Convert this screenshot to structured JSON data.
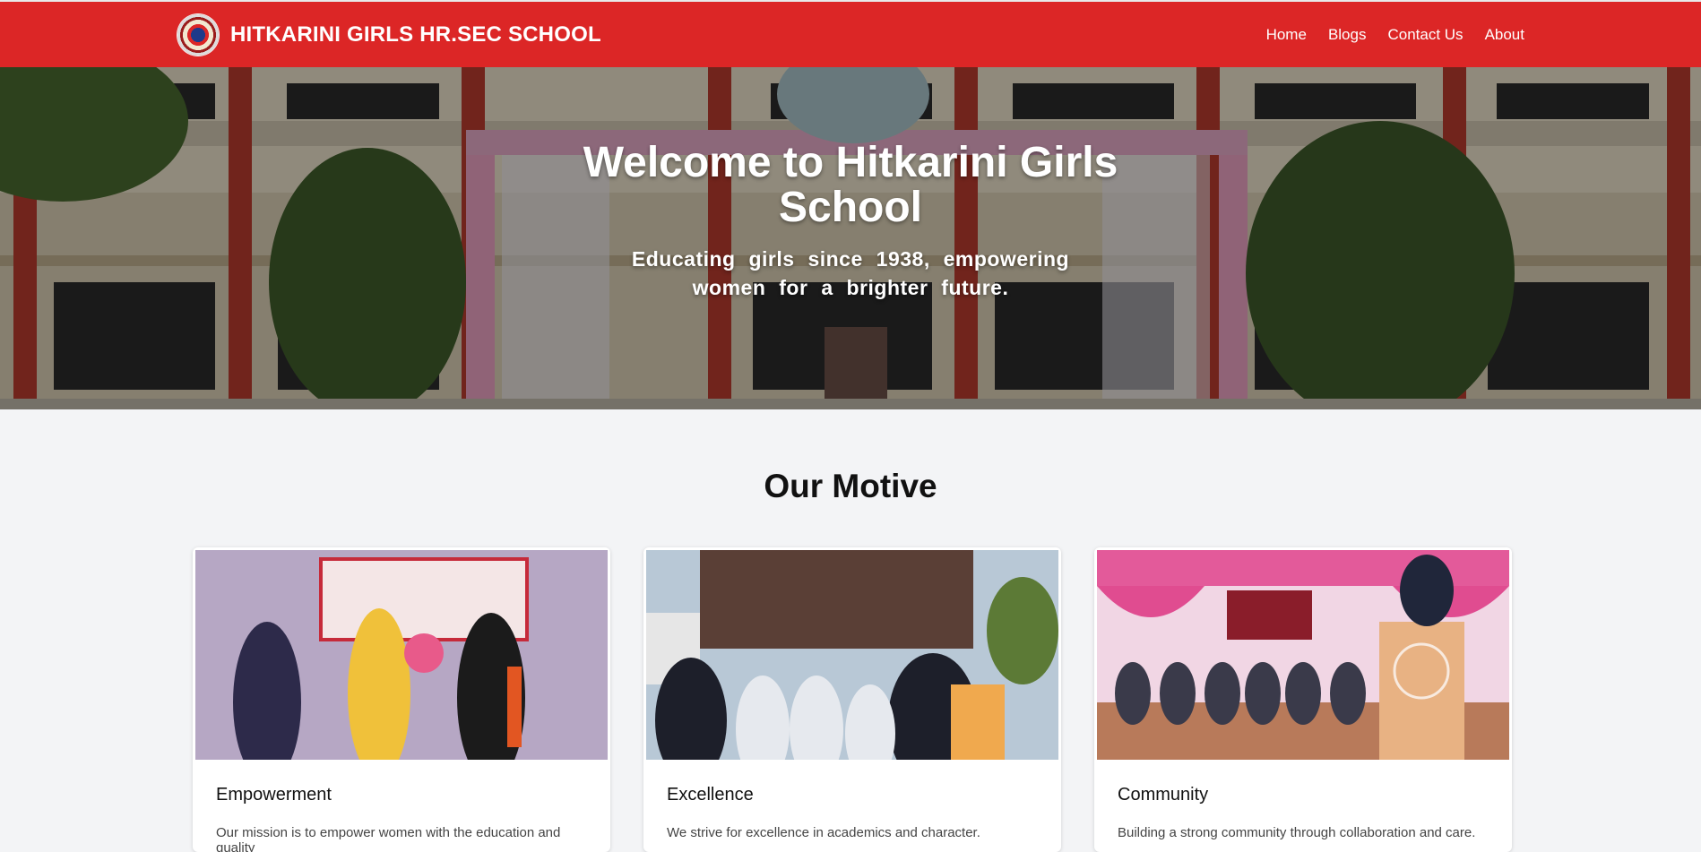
{
  "navbar": {
    "brand": "HITKARINI GIRLS HR.SEC SCHOOL",
    "links": [
      "Home",
      "Blogs",
      "Contact Us",
      "About"
    ]
  },
  "hero": {
    "title": "Welcome to Hitkarini Girls School",
    "subtitle": "Educating girls since 1938, empowering women for a brighter future."
  },
  "motive": {
    "title": "Our Motive",
    "cards": [
      {
        "title": "Empowerment",
        "text": "Our mission is to empower women with the education and quality"
      },
      {
        "title": "Excellence",
        "text": "We strive for excellence in academics and character."
      },
      {
        "title": "Community",
        "text": "Building a strong community through collaboration and care."
      }
    ]
  },
  "colors": {
    "nav_red": "#dc2626",
    "page_bg": "#f3f4f6"
  },
  "icons": [
    "school-logo-icon"
  ]
}
